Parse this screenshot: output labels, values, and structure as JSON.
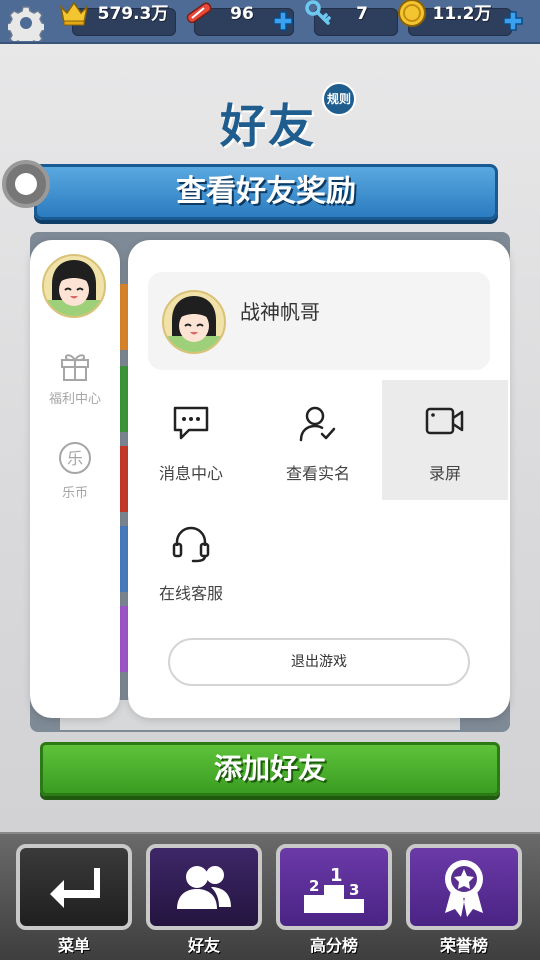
{
  "topbar": {
    "crowns": "579.3万",
    "tickets": "96",
    "keys": "7",
    "coins": "11.2万"
  },
  "page": {
    "title": "好友",
    "rule_label": "规则",
    "reward_button": "查看好友奖励",
    "add_friend_button": "添加好友"
  },
  "bottom_nav": [
    {
      "label": "菜单"
    },
    {
      "label": "好友"
    },
    {
      "label": "高分榜"
    },
    {
      "label": "荣誉榜"
    }
  ],
  "overlay": {
    "rail": [
      {
        "label": "福利中心"
      },
      {
        "label": "乐币"
      }
    ],
    "user_name": "战神帆哥",
    "menu": [
      {
        "label": "消息中心"
      },
      {
        "label": "查看实名"
      },
      {
        "label": "录屏"
      },
      {
        "label": "在线客服"
      }
    ],
    "exit_label": "退出游戏"
  },
  "colors": {
    "topbar": "#4e6b95",
    "reward_blue": "#2b7cc0",
    "add_green": "#3a9d22",
    "purple_nav": "#5a2d91"
  }
}
